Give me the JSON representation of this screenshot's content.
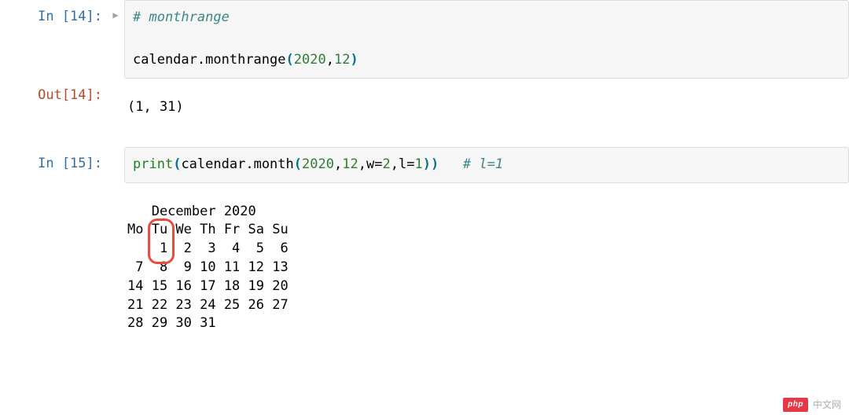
{
  "cell1": {
    "prompt": "In [14]:",
    "line1_comment": "# monthrange",
    "line2_a": "calendar",
    "line2_b": ".",
    "line2_c": "monthrange",
    "line2_d": "(",
    "line2_e": "2020",
    "line2_f": ",",
    "line2_g": "12",
    "line2_h": ")"
  },
  "out1": {
    "prompt": "Out[14]:",
    "text": "(1, 31)"
  },
  "cell2": {
    "prompt": "In [15]:",
    "a_print": "print",
    "b_lp": "(",
    "c_cal": "calendar",
    "d_dot": ".",
    "e_month": "month",
    "f_lp": "(",
    "g_n1": "2020",
    "h_c": ",",
    "i_n2": "12",
    "j_c": ",",
    "k_w": "w",
    "l_eq": "=",
    "m_n3": "2",
    "n_c": ",",
    "o_l": "l",
    "p_eq": "=",
    "q_n4": "1",
    "r_rp": ")",
    "s_rp": ")",
    "t_sp": "   ",
    "u_comment": "# l=1"
  },
  "calendar_out": "   December 2020\nMo Tu We Th Fr Sa Su\n    1  2  3  4  5  6\n 7  8  9 10 11 12 13\n14 15 16 17 18 19 20\n21 22 23 24 25 26 27\n28 29 30 31",
  "highlight": {
    "top_line": 1,
    "bottom_line": 2,
    "col_start": 3,
    "col_end": 5
  },
  "watermark": {
    "pill": "php",
    "text": "中文网"
  }
}
